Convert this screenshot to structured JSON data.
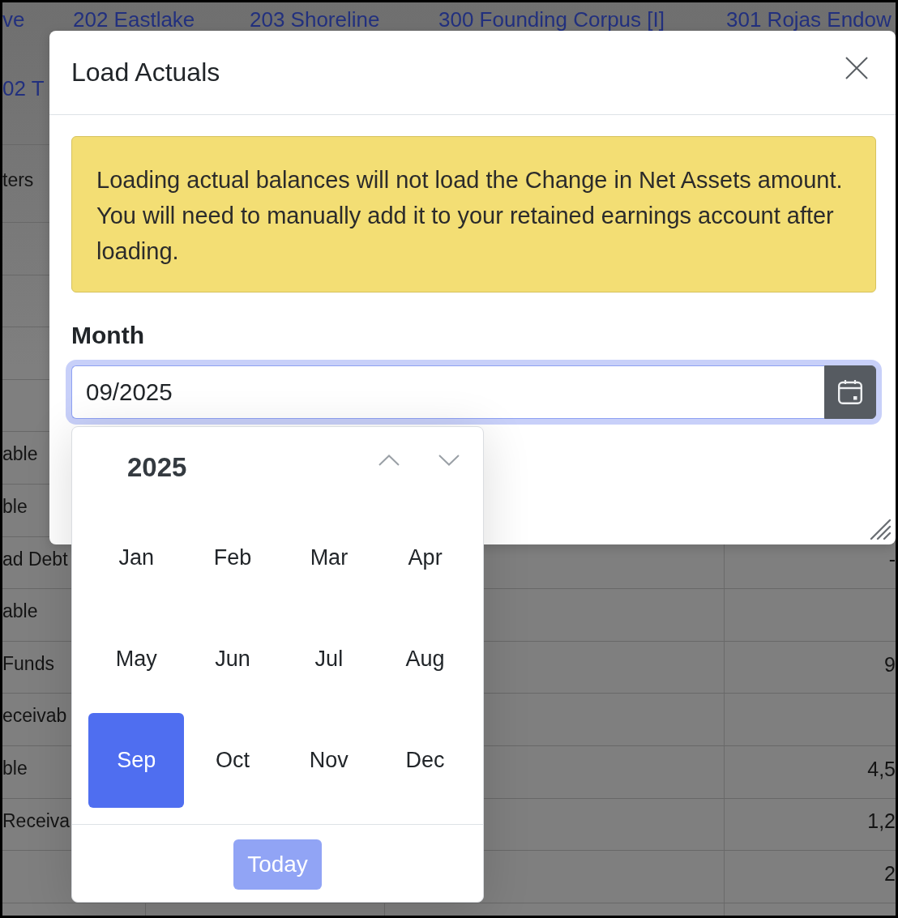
{
  "background_table": {
    "header_line_1": [
      "ve",
      "202 Eastlake",
      "203 Shoreline",
      "300 Founding Corpus [I]",
      "301 Rojas Endow"
    ],
    "header_line_2": [
      "02 T"
    ],
    "rows": [
      {
        "label": "ters"
      },
      {},
      {},
      {},
      {},
      {
        "label": "able"
      },
      {
        "label": "ble"
      },
      {
        "label": "ad Debt",
        "value": "-"
      },
      {
        "label": "able"
      },
      {
        "label": "Funds",
        "value": "9"
      },
      {
        "label": "eceivab"
      },
      {
        "label": "ble",
        "value": "4,5"
      },
      {
        "label": "Receiva",
        "value": "1,2"
      },
      {
        "value": "2"
      },
      {}
    ]
  },
  "modal": {
    "title": "Load Actuals",
    "alert": "Loading actual balances will not load the Change in Net Assets amount. You will need to manually add it to your retained earnings account after loading.",
    "field": {
      "label": "Month",
      "value": "09/2025",
      "focused": true
    },
    "datepicker": {
      "year": "2025",
      "months": [
        {
          "label": "Jan",
          "selected": false
        },
        {
          "label": "Feb",
          "selected": false
        },
        {
          "label": "Mar",
          "selected": false
        },
        {
          "label": "Apr",
          "selected": false
        },
        {
          "label": "May",
          "selected": false
        },
        {
          "label": "Jun",
          "selected": false
        },
        {
          "label": "Jul",
          "selected": false
        },
        {
          "label": "Aug",
          "selected": false
        },
        {
          "label": "Sep",
          "selected": true
        },
        {
          "label": "Oct",
          "selected": false
        },
        {
          "label": "Nov",
          "selected": false
        },
        {
          "label": "Dec",
          "selected": false
        }
      ],
      "today_button": {
        "label": "Today",
        "disabled": true
      }
    }
  }
}
